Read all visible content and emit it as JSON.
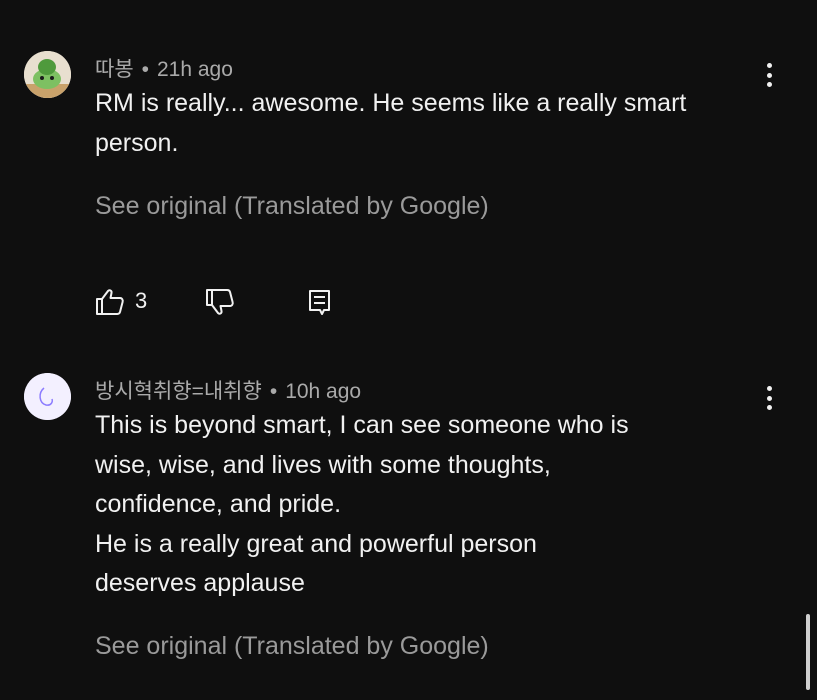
{
  "comments": [
    {
      "author": "따봉",
      "separator": "•",
      "time": "21h ago",
      "lines": [
        "RM is really... awesome. He seems like a really smart",
        "person."
      ],
      "translate_label": "See original (Translated by Google)",
      "like_count": "3",
      "avatar_icon": "pokemon-avatar-icon",
      "avatar_color": "#6fbf4c"
    },
    {
      "author": "방시혁취향=내취향",
      "separator": "•",
      "time": "10h ago",
      "lines": [
        "This is beyond smart, I can see someone who is",
        "wise, wise, and lives with some thoughts,",
        "confidence, and pride.",
        "He is a really great and powerful person",
        "deserves applause"
      ],
      "translate_label": "See original (Translated by Google)",
      "avatar_icon": "smile-avatar-icon",
      "avatar_color": "#f3f0ff"
    }
  ],
  "icons": {
    "more": "more-vert-icon",
    "like": "thumb-up-icon",
    "dislike": "thumb-down-icon",
    "reply": "reply-icon"
  }
}
